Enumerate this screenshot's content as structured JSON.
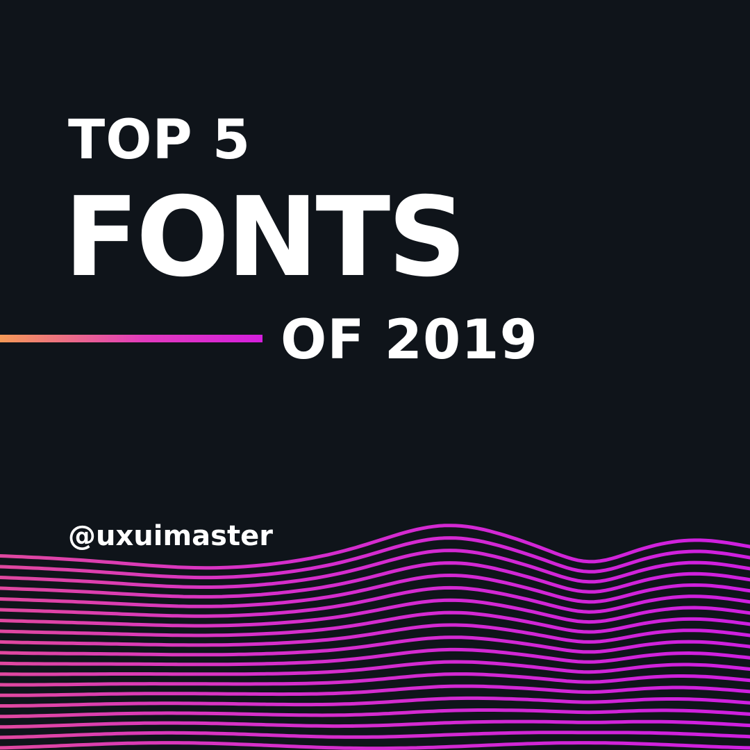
{
  "headline": {
    "line1": "TOP 5",
    "line2": "FONTS",
    "line3": "OF 2019"
  },
  "handle": "@uxuimaster",
  "colors": {
    "background": "#0f141a",
    "text": "#ffffff",
    "accent_start": "#f59a57",
    "accent_end": "#d41fdd",
    "wave": "#d52ad6"
  }
}
